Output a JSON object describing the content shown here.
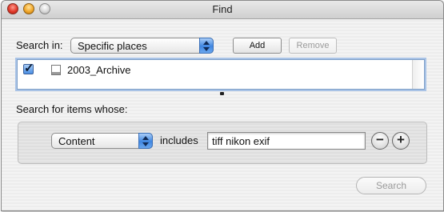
{
  "window": {
    "title": "Find"
  },
  "search_in": {
    "label": "Search in:",
    "selected": "Specific places",
    "add_label": "Add",
    "remove_label": "Remove",
    "locations": [
      {
        "name": "2003_Archive",
        "checked": true
      }
    ]
  },
  "criteria": {
    "heading": "Search for items whose:",
    "rows": [
      {
        "attribute": "Content",
        "operator": "includes",
        "value": "tiff nikon exif"
      }
    ],
    "remove_symbol": "−",
    "add_symbol": "+"
  },
  "footer": {
    "search_label": "Search"
  }
}
